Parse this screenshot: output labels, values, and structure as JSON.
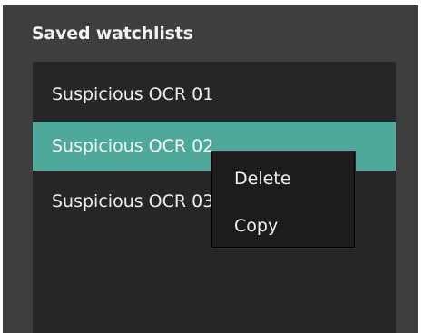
{
  "panel": {
    "title": "Saved watchlists"
  },
  "watchlists": [
    {
      "label": "Suspicious OCR 01"
    },
    {
      "label": "Suspicious OCR 02"
    },
    {
      "label": "Suspicious OCR 03"
    }
  ],
  "context_menu": {
    "items": [
      {
        "label": "Delete"
      },
      {
        "label": "Copy"
      }
    ]
  },
  "colors": {
    "panel_bg": "#3e3e3e",
    "list_bg": "#262626",
    "selected_bg": "#4fa99a",
    "menu_bg": "#1c1c1c"
  }
}
